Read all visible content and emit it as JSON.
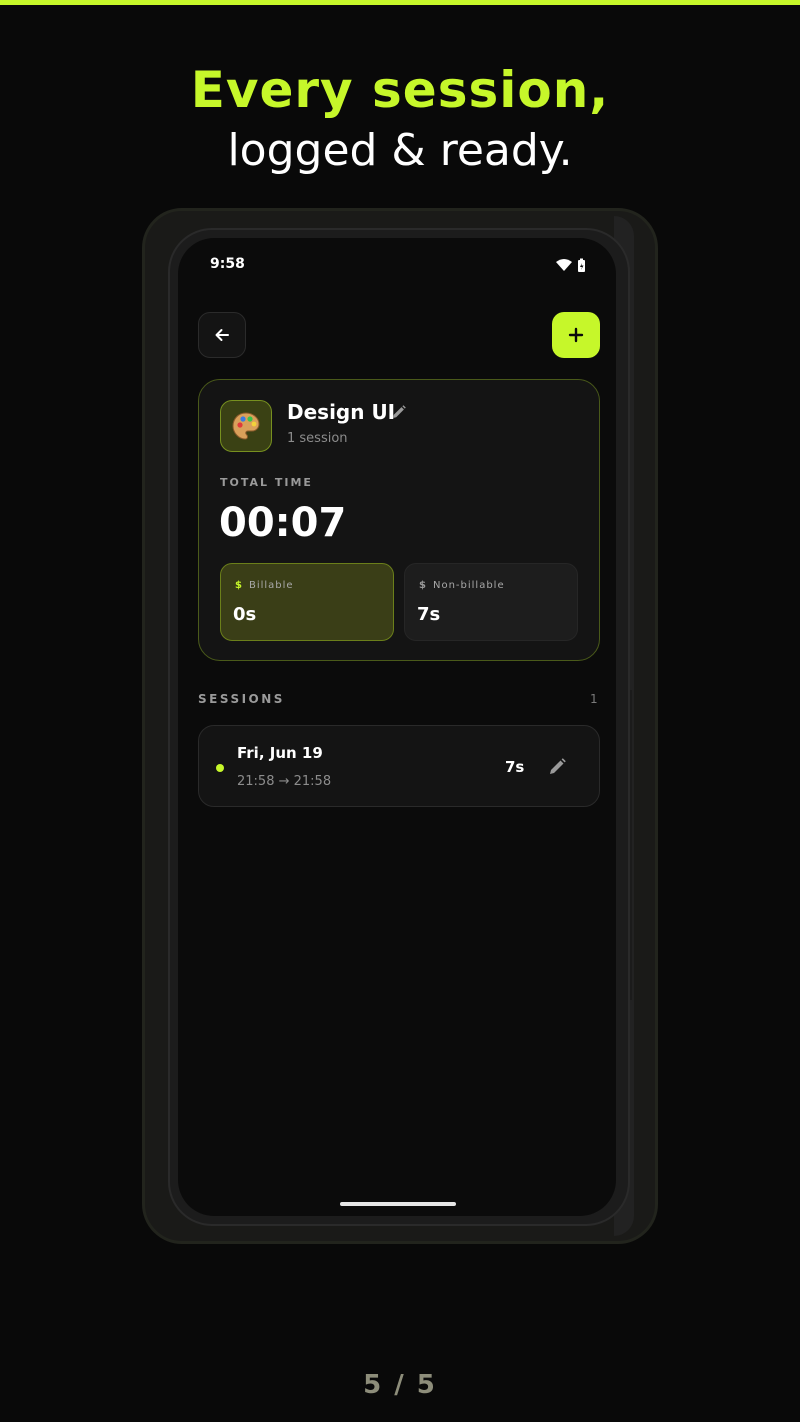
{
  "promo": {
    "headline": "Every session,",
    "subheadline": "logged & ready.",
    "pager": "5 / 5"
  },
  "status_bar": {
    "time": "9:58",
    "icons": [
      "wifi-icon",
      "battery-icon"
    ]
  },
  "toolbar": {
    "back_icon": "arrow-left-icon",
    "add_icon": "plus-icon"
  },
  "project": {
    "icon": "palette-icon",
    "name": "Design UI",
    "session_count": "1 session",
    "total_label": "TOTAL TIME",
    "total_value": "00:07",
    "billable": {
      "symbol": "$",
      "label": "Billable",
      "value": "0s"
    },
    "non_billable": {
      "symbol": "$",
      "label": "Non-billable",
      "value": "7s"
    }
  },
  "sessions": {
    "label": "SESSIONS",
    "count": "1",
    "items": [
      {
        "date": "Fri, Jun 19",
        "range": "21:58 → 21:58",
        "duration": "7s",
        "edit_icon": "pencil-icon"
      }
    ]
  },
  "colors": {
    "accent": "#c6f72a",
    "background": "#090909",
    "card": "#141414"
  }
}
